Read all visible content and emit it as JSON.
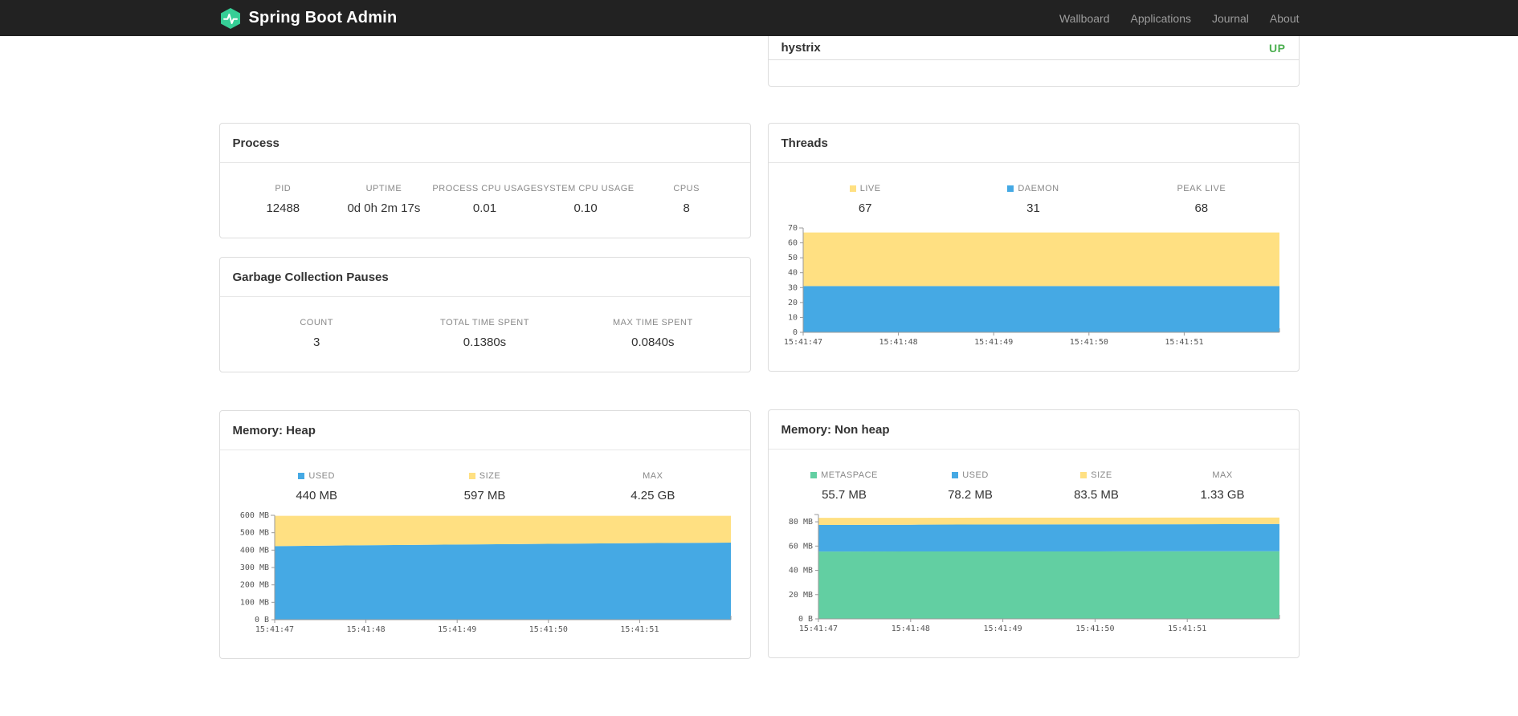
{
  "navbar": {
    "brand": "Spring Boot Admin",
    "links": [
      {
        "label": "Wallboard"
      },
      {
        "label": "Applications"
      },
      {
        "label": "Journal"
      },
      {
        "label": "About"
      }
    ]
  },
  "applications": {
    "name": "hystrix",
    "status": "UP",
    "status_color": "#4caf50"
  },
  "panels": {
    "process": {
      "title": "Process",
      "metrics": [
        {
          "label": "PID",
          "value": "12488"
        },
        {
          "label": "UPTIME",
          "value": "0d 0h 2m 17s"
        },
        {
          "label": "PROCESS CPU USAGE",
          "value": "0.01"
        },
        {
          "label": "SYSTEM CPU USAGE",
          "value": "0.10"
        },
        {
          "label": "CPUS",
          "value": "8"
        }
      ]
    },
    "gc": {
      "title": "Garbage Collection Pauses",
      "metrics": [
        {
          "label": "COUNT",
          "value": "3"
        },
        {
          "label": "TOTAL TIME SPENT",
          "value": "0.1380s"
        },
        {
          "label": "MAX TIME SPENT",
          "value": "0.0840s"
        }
      ]
    },
    "threads": {
      "title": "Threads",
      "legend": [
        {
          "label": "LIVE",
          "value": "67",
          "color": "#ffe082"
        },
        {
          "label": "DAEMON",
          "value": "31",
          "color": "#45a9e4"
        },
        {
          "label": "PEAK LIVE",
          "value": "68"
        }
      ]
    },
    "heap": {
      "title": "Memory: Heap",
      "legend": [
        {
          "label": "USED",
          "value": "440 MB",
          "color": "#45a9e4"
        },
        {
          "label": "SIZE",
          "value": "597 MB",
          "color": "#ffe082"
        },
        {
          "label": "MAX",
          "value": "4.25 GB"
        }
      ]
    },
    "nonheap": {
      "title": "Memory: Non heap",
      "legend": [
        {
          "label": "METASPACE",
          "value": "55.7 MB",
          "color": "#62cfa2"
        },
        {
          "label": "USED",
          "value": "78.2 MB",
          "color": "#45a9e4"
        },
        {
          "label": "SIZE",
          "value": "83.5 MB",
          "color": "#ffe082"
        },
        {
          "label": "MAX",
          "value": "1.33 GB"
        }
      ]
    }
  },
  "chart_data": [
    {
      "id": "threads",
      "type": "area",
      "title": "Threads",
      "x_tick_labels": [
        "15:41:47",
        "15:41:48",
        "15:41:49",
        "15:41:50",
        "15:41:51"
      ],
      "x_tick_fractions": [
        0,
        0.2,
        0.4,
        0.6,
        0.8
      ],
      "point_fractions": [
        0,
        0.2,
        0.4,
        0.6,
        0.8,
        1
      ],
      "ylim": [
        0,
        70
      ],
      "yticks": [
        0,
        10,
        20,
        30,
        40,
        50,
        60,
        70
      ],
      "ytick_labels": [
        "0",
        "10",
        "20",
        "30",
        "40",
        "50",
        "60",
        "70"
      ],
      "legend_position": "top",
      "grid": false,
      "series": [
        {
          "name": "DAEMON",
          "color": "#45a9e4",
          "tops": [
            31,
            31,
            31,
            31,
            31,
            31
          ]
        },
        {
          "name": "LIVE",
          "color": "#ffe082",
          "tops": [
            67,
            67,
            67,
            67,
            67,
            67
          ]
        }
      ]
    },
    {
      "id": "heap",
      "type": "area",
      "title": "Memory: Heap",
      "x_tick_labels": [
        "15:41:47",
        "15:41:48",
        "15:41:49",
        "15:41:50",
        "15:41:51"
      ],
      "x_tick_fractions": [
        0,
        0.2,
        0.4,
        0.6,
        0.8
      ],
      "point_fractions": [
        0,
        0.2,
        0.4,
        0.6,
        0.8,
        1
      ],
      "ylim": [
        0,
        600
      ],
      "yticks": [
        0,
        100,
        200,
        300,
        400,
        500,
        600
      ],
      "ytick_labels": [
        "0 B",
        "100 MB",
        "200 MB",
        "300 MB",
        "400 MB",
        "500 MB",
        "600 MB"
      ],
      "legend_position": "top",
      "grid": false,
      "series": [
        {
          "name": "USED",
          "color": "#45a9e4",
          "tops": [
            423,
            428,
            432,
            436,
            440,
            443
          ]
        },
        {
          "name": "SIZE",
          "color": "#ffe082",
          "tops": [
            597,
            597,
            597,
            597,
            597,
            597
          ]
        }
      ]
    },
    {
      "id": "nonheap",
      "type": "area",
      "title": "Memory: Non heap",
      "x_tick_labels": [
        "15:41:47",
        "15:41:48",
        "15:41:49",
        "15:41:50",
        "15:41:51"
      ],
      "x_tick_fractions": [
        0,
        0.2,
        0.4,
        0.6,
        0.8
      ],
      "point_fractions": [
        0,
        0.2,
        0.4,
        0.6,
        0.8,
        1
      ],
      "ylim": [
        0,
        86
      ],
      "yticks": [
        0,
        20,
        40,
        60,
        80
      ],
      "ytick_labels": [
        "0 B",
        "20 MB",
        "40 MB",
        "60 MB",
        "80 MB"
      ],
      "legend_position": "top",
      "grid": false,
      "series": [
        {
          "name": "METASPACE",
          "color": "#62cfa2",
          "tops": [
            55.5,
            55.6,
            55.6,
            55.6,
            55.7,
            55.7
          ]
        },
        {
          "name": "USED",
          "color": "#45a9e4",
          "tops": [
            77.4,
            77.6,
            77.8,
            77.9,
            78.0,
            78.2
          ]
        },
        {
          "name": "SIZE",
          "color": "#ffe082",
          "tops": [
            83.3,
            83.3,
            83.4,
            83.4,
            83.5,
            83.5
          ]
        }
      ]
    }
  ]
}
